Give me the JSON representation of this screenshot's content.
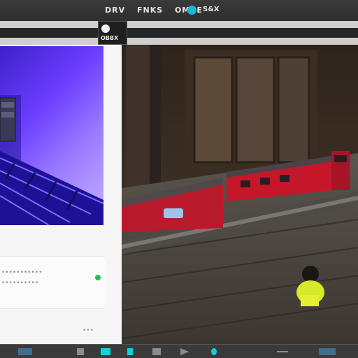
{
  "window": {
    "title_parts": [
      "DRV",
      "FNKS",
      "OMCE"
    ],
    "title_after": "S&X",
    "status_color": "#18b8d6"
  },
  "toolbar": {
    "button_label": "OBBX",
    "button_icon": "circle-icon"
  },
  "left_panel": {
    "preview_image": "purple-3d-room-with-rails",
    "info_line1": "•••••••••••",
    "info_line2": "••••••••••",
    "status_dot_color": "#22c14b",
    "footer_label": "•••"
  },
  "main_view": {
    "image": "toy-train-with-child-in-room"
  },
  "bottom_bar": {
    "icons": [
      "app-icon",
      "tool-icon",
      "cyan-square-icon",
      "cyan-bar-icon",
      "square-icon",
      "play-icon",
      "dot-icon",
      "line-icon",
      "app-icon-right"
    ]
  }
}
